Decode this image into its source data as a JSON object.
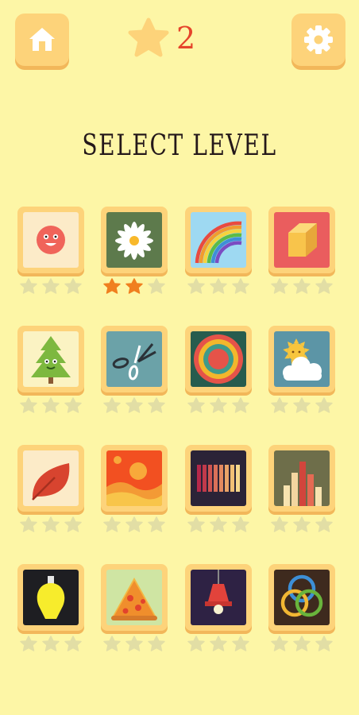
{
  "header": {
    "score": "2",
    "home_icon": "home-icon",
    "settings_icon": "gear-icon",
    "star_icon": "star-icon"
  },
  "title": "SELECT LEVEL",
  "colors": {
    "background": "#FDF6A6",
    "tile": "#FDD37A",
    "star_empty": "#E2DEA5",
    "star_earned": "#F07F1F",
    "accent_text": "#E5452B"
  },
  "levels": [
    {
      "icon": "smiley-face",
      "stars": 0
    },
    {
      "icon": "daisy-flower",
      "stars": 2
    },
    {
      "icon": "rainbow",
      "stars": 0
    },
    {
      "icon": "cube",
      "stars": 0
    },
    {
      "icon": "pine-tree",
      "stars": 0
    },
    {
      "icon": "scissors",
      "stars": 0
    },
    {
      "icon": "concentric-circles",
      "stars": 0
    },
    {
      "icon": "sun-behind-cloud",
      "stars": 0
    },
    {
      "icon": "leaf",
      "stars": 0
    },
    {
      "icon": "sunset-landscape",
      "stars": 0
    },
    {
      "icon": "vertical-stripes",
      "stars": 0
    },
    {
      "icon": "bar-buildings",
      "stars": 0
    },
    {
      "icon": "light-bulb",
      "stars": 0
    },
    {
      "icon": "pizza-slice",
      "stars": 0
    },
    {
      "icon": "ceiling-lamp",
      "stars": 0
    },
    {
      "icon": "interlocking-rings",
      "stars": 0
    }
  ]
}
